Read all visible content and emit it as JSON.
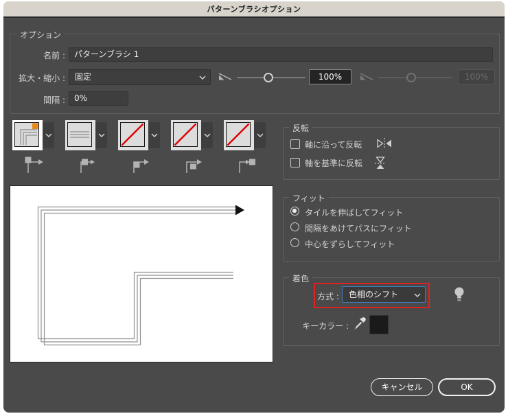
{
  "title": "パターンブラシオプション",
  "options": {
    "group_label": "オプション",
    "name_label": "名前 :",
    "name_value": "パターンブラシ 1",
    "scale_label": "拡大・縮小 :",
    "scale_value": "固定",
    "scale_percent": "100%",
    "scale_percent_disabled": "100%",
    "spacing_label": "間隔 :",
    "spacing_value": "0%"
  },
  "tiles": {
    "slots": [
      {
        "name": "outer-corner-tile",
        "pattern": "corner-lines",
        "selected": true,
        "corner_marker_color": "#e8891d"
      },
      {
        "name": "side-tile",
        "pattern": "horizontal-lines",
        "selected": false
      },
      {
        "name": "inner-corner-tile",
        "pattern": "none",
        "selected": false
      },
      {
        "name": "start-tile",
        "pattern": "none",
        "selected": false
      },
      {
        "name": "end-tile",
        "pattern": "none",
        "selected": false
      }
    ],
    "none_slash_color": "#dd0000"
  },
  "flip": {
    "group_label": "反転",
    "items": [
      {
        "label": "軸に沿って反転",
        "checked": false,
        "icon": "flip-horizontal-icon"
      },
      {
        "label": "軸を基準に反転",
        "checked": false,
        "icon": "flip-vertical-icon"
      }
    ]
  },
  "fit": {
    "group_label": "フィット",
    "options": [
      {
        "label": "タイルを伸ばしてフィット",
        "selected": true
      },
      {
        "label": "間隔をあけてパスにフィット",
        "selected": false
      },
      {
        "label": "中心をずらしてフィット",
        "selected": false
      }
    ]
  },
  "colorization": {
    "group_label": "着色",
    "method_label": "方式 :",
    "method_value": "色相のシフト",
    "key_color_label": "キーカラー :",
    "key_color_value": "#1a1a1a",
    "annotation_color": "#e02120",
    "dropdown_focus_color": "#3f7dbf"
  },
  "buttons": {
    "cancel": "キャンセル",
    "ok": "OK"
  },
  "icons": {
    "slider_variation": "pressure-slider-icon",
    "tile_menu": "chevron-down-icon",
    "tips": "lightbulb-icon",
    "key_color_picker": "eyedropper-icon"
  },
  "colors": {
    "dialog_bg": "#4a4a4a",
    "titlebar_bg": "#d8d4cc",
    "preview_bg": "#ffffff",
    "preview_stroke": "#8f8f8f"
  }
}
